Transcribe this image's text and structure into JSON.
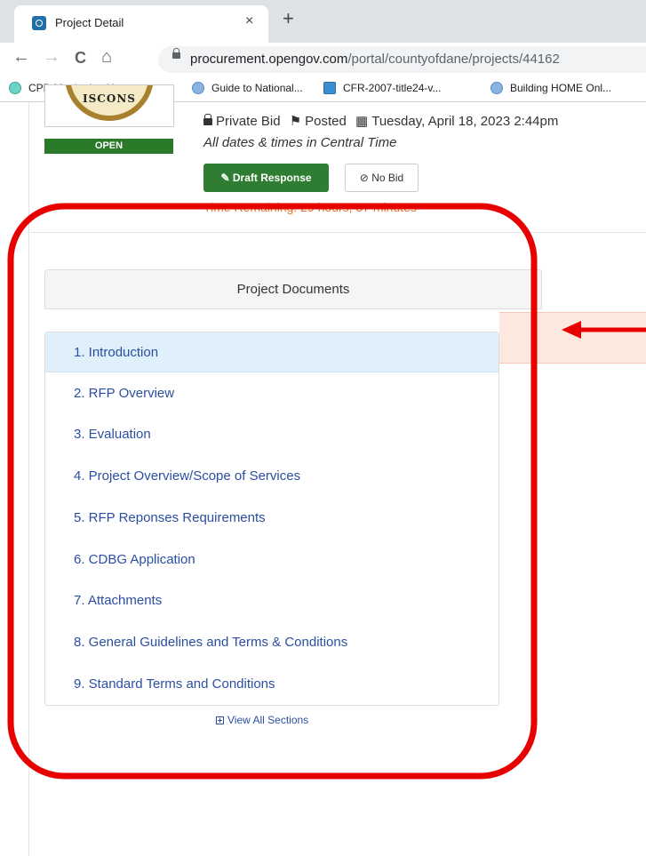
{
  "browser": {
    "tab_title": "Project Detail",
    "tab_close": "×",
    "new_tab": "+",
    "nav": {
      "back": "←",
      "forward": "→",
      "reload": "C",
      "home": "⌂"
    },
    "url_host": "procurement.opengov.com",
    "url_path": "/portal/countyofdane/projects/44162",
    "bookmarks": [
      {
        "label": "CPD Monitoring Ha...",
        "icon": "globe-icon"
      },
      {
        "label": "Guide to National...",
        "icon": "globe-icon"
      },
      {
        "label": "CFR-2007-title24-v...",
        "icon": "cfr-icon"
      },
      {
        "label": "Building HOME Onl...",
        "icon": "globe-icon"
      }
    ]
  },
  "project": {
    "seal_text": "ISCONS",
    "status": "OPEN",
    "bid_type": "Private Bid",
    "posted_label": "Posted",
    "posted_date": "Tuesday, April 18, 2023 2:44pm",
    "timezone_note": "All dates & times in Central Time",
    "draft_button": "Draft Response",
    "no_bid_button": "No Bid",
    "time_remaining": "Time Remaining: 29 hours, 37 minutes"
  },
  "documents": {
    "heading": "Project Documents",
    "sections": [
      "1. Introduction",
      "2. RFP Overview",
      "3. Evaluation",
      "4. Project Overview/Scope of Services",
      "5. RFP Reponses Requirements",
      "6. CDBG Application",
      "7. Attachments",
      "8. General Guidelines and Terms & Conditions",
      "9. Standard Terms and Conditions"
    ],
    "active_index": 0,
    "view_all": "View All Sections"
  },
  "colors": {
    "annotation": "#e60000",
    "status_green": "#2a7a2a",
    "link_blue": "#2b4ea2",
    "active_row": "#dff0fb"
  }
}
